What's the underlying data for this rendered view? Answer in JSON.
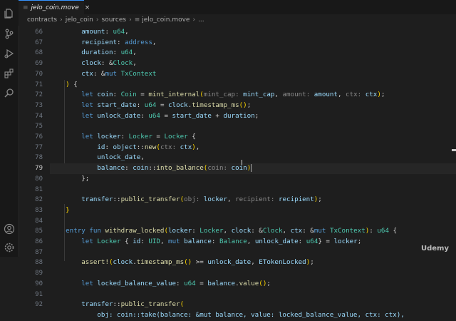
{
  "tab": {
    "icon": "≡",
    "label": "jelo_coin.move",
    "close": "×"
  },
  "breadcrumb": [
    "contracts",
    "jelo_coin",
    "sources"
  ],
  "breadcrumb_file": {
    "icon": "≡",
    "label": "jelo_coin.move"
  },
  "breadcrumb_tail": "...",
  "activity_icons": [
    "files-icon",
    "source-control-icon",
    "run-debug-icon",
    "extensions-icon",
    "search-icon",
    "account-icon",
    "settings-gear-icon"
  ],
  "line_numbers": [
    "66",
    "67",
    "68",
    "69",
    "70",
    "71",
    "72",
    "73",
    "74",
    "75",
    "76",
    "77",
    "78",
    "79",
    "80",
    "81",
    "82",
    "83",
    "84",
    "85",
    "86",
    "87",
    "88",
    "89",
    "90",
    "91",
    "92"
  ],
  "active_line": "79",
  "watermark": "Udemy",
  "code_tokens": [
    [
      [
        "id",
        "        amount"
      ],
      [
        "op",
        ": "
      ],
      [
        "ty",
        "u64"
      ],
      [
        "op",
        ","
      ]
    ],
    [
      [
        "id",
        "        recipient"
      ],
      [
        "op",
        ": "
      ],
      [
        "kw",
        "address"
      ],
      [
        "op",
        ","
      ]
    ],
    [
      [
        "id",
        "        duration"
      ],
      [
        "op",
        ": "
      ],
      [
        "ty",
        "u64"
      ],
      [
        "op",
        ","
      ]
    ],
    [
      [
        "id",
        "        clock"
      ],
      [
        "op",
        ": &"
      ],
      [
        "ty",
        "Clock"
      ],
      [
        "op",
        ","
      ]
    ],
    [
      [
        "id",
        "        ctx"
      ],
      [
        "op",
        ": &"
      ],
      [
        "kw",
        "mut "
      ],
      [
        "ty",
        "TxContext"
      ]
    ],
    [
      [
        "pn",
        "    )"
      ],
      [
        "op",
        " {"
      ]
    ],
    [
      [
        "kw",
        "        let "
      ],
      [
        "id",
        "coin"
      ],
      [
        "op",
        ": "
      ],
      [
        "ty",
        "Coin"
      ],
      [
        "op",
        " = "
      ],
      [
        "fn",
        "mint_internal"
      ],
      [
        "pn",
        "("
      ],
      [
        "hint",
        "mint_cap: "
      ],
      [
        "id",
        "mint_cap"
      ],
      [
        "op",
        ", "
      ],
      [
        "hint",
        "amount: "
      ],
      [
        "id",
        "amount"
      ],
      [
        "op",
        ", "
      ],
      [
        "hint",
        "ctx: "
      ],
      [
        "id",
        "ctx"
      ],
      [
        "pn",
        ")"
      ],
      [
        "op",
        ";"
      ]
    ],
    [
      [
        "kw",
        "        let "
      ],
      [
        "id",
        "start_date"
      ],
      [
        "op",
        ": "
      ],
      [
        "ty",
        "u64"
      ],
      [
        "op",
        " = "
      ],
      [
        "id",
        "clock"
      ],
      [
        "op",
        "."
      ],
      [
        "fn",
        "timestamp_ms"
      ],
      [
        "pn",
        "()"
      ],
      [
        "op",
        ";"
      ]
    ],
    [
      [
        "kw",
        "        let "
      ],
      [
        "id",
        "unlock_date"
      ],
      [
        "op",
        ": "
      ],
      [
        "ty",
        "u64"
      ],
      [
        "op",
        " = "
      ],
      [
        "id",
        "start_date"
      ],
      [
        "op",
        " + "
      ],
      [
        "id",
        "duration"
      ],
      [
        "op",
        ";"
      ]
    ],
    [
      [
        "op",
        ""
      ]
    ],
    [
      [
        "kw",
        "        let "
      ],
      [
        "id",
        "locker"
      ],
      [
        "op",
        ": "
      ],
      [
        "ty",
        "Locker"
      ],
      [
        "op",
        " = "
      ],
      [
        "ty",
        "Locker"
      ],
      [
        "op",
        " {"
      ]
    ],
    [
      [
        "id",
        "            id"
      ],
      [
        "op",
        ": "
      ],
      [
        "id",
        "object"
      ],
      [
        "op",
        "::"
      ],
      [
        "fn",
        "new"
      ],
      [
        "pn",
        "("
      ],
      [
        "hint",
        "ctx: "
      ],
      [
        "id",
        "ctx"
      ],
      [
        "pn",
        ")"
      ],
      [
        "op",
        ","
      ]
    ],
    [
      [
        "id",
        "            unlock_date"
      ],
      [
        "op",
        ","
      ]
    ],
    [
      [
        "id",
        "            balance"
      ],
      [
        "op",
        ": "
      ],
      [
        "id",
        "coin"
      ],
      [
        "op",
        "::"
      ],
      [
        "fn",
        "into_balance"
      ],
      [
        "pn",
        "("
      ],
      [
        "hint",
        "coin: "
      ],
      [
        "id",
        "coin"
      ],
      [
        "pn",
        ")"
      ]
    ],
    [
      [
        "op",
        "        };"
      ]
    ],
    [
      [
        "op",
        ""
      ]
    ],
    [
      [
        "id",
        "        transfer"
      ],
      [
        "op",
        "::"
      ],
      [
        "fn",
        "public_transfer"
      ],
      [
        "pn",
        "("
      ],
      [
        "hint",
        "obj: "
      ],
      [
        "id",
        "locker"
      ],
      [
        "op",
        ", "
      ],
      [
        "hint",
        "recipient: "
      ],
      [
        "id",
        "recipient"
      ],
      [
        "pn",
        ")"
      ],
      [
        "op",
        ";"
      ]
    ],
    [
      [
        "pn",
        "    }"
      ]
    ],
    [
      [
        "op",
        ""
      ]
    ],
    [
      [
        "kw",
        "    entry "
      ],
      [
        "kw",
        "fun "
      ],
      [
        "fn",
        "withdraw_locked"
      ],
      [
        "pn",
        "("
      ],
      [
        "id",
        "locker"
      ],
      [
        "op",
        ": "
      ],
      [
        "ty",
        "Locker"
      ],
      [
        "op",
        ", "
      ],
      [
        "id",
        "clock"
      ],
      [
        "op",
        ": &"
      ],
      [
        "ty",
        "Clock"
      ],
      [
        "op",
        ", "
      ],
      [
        "id",
        "ctx"
      ],
      [
        "op",
        ": &"
      ],
      [
        "kw",
        "mut "
      ],
      [
        "ty",
        "TxContext"
      ],
      [
        "pn",
        ")"
      ],
      [
        "op",
        ": "
      ],
      [
        "ty",
        "u64"
      ],
      [
        "op",
        " {"
      ]
    ],
    [
      [
        "kw",
        "        let "
      ],
      [
        "ty",
        "Locker"
      ],
      [
        "op",
        " { "
      ],
      [
        "id",
        "id"
      ],
      [
        "op",
        ": "
      ],
      [
        "ty",
        "UID"
      ],
      [
        "op",
        ", "
      ],
      [
        "kw",
        "mut "
      ],
      [
        "id",
        "balance"
      ],
      [
        "op",
        ": "
      ],
      [
        "ty",
        "Balance"
      ],
      [
        "op",
        ", "
      ],
      [
        "id",
        "unlock_date"
      ],
      [
        "op",
        ": "
      ],
      [
        "ty",
        "u64"
      ],
      [
        "op",
        "} = "
      ],
      [
        "id",
        "locker"
      ],
      [
        "op",
        ";"
      ]
    ],
    [
      [
        "op",
        ""
      ]
    ],
    [
      [
        "fn",
        "        assert!"
      ],
      [
        "pn",
        "("
      ],
      [
        "id",
        "clock"
      ],
      [
        "op",
        "."
      ],
      [
        "fn",
        "timestamp_ms"
      ],
      [
        "pn",
        "()"
      ],
      [
        "op",
        " >= "
      ],
      [
        "id",
        "unlock_date"
      ],
      [
        "op",
        ", "
      ],
      [
        "id",
        "ETokenLocked"
      ],
      [
        "pn",
        ")"
      ],
      [
        "op",
        ";"
      ]
    ],
    [
      [
        "op",
        ""
      ]
    ],
    [
      [
        "kw",
        "        let "
      ],
      [
        "id",
        "locked_balance_value"
      ],
      [
        "op",
        ": "
      ],
      [
        "ty",
        "u64"
      ],
      [
        "op",
        " = "
      ],
      [
        "id",
        "balance"
      ],
      [
        "op",
        "."
      ],
      [
        "fn",
        "value"
      ],
      [
        "pn",
        "()"
      ],
      [
        "op",
        ";"
      ]
    ],
    [
      [
        "op",
        ""
      ]
    ],
    [
      [
        "id",
        "        transfer"
      ],
      [
        "op",
        "::"
      ],
      [
        "fn",
        "public_transfer"
      ],
      [
        "pn",
        "("
      ]
    ]
  ],
  "line_93_partial": "            obj: coin::take(balance: &mut balance, value: locked_balance_value, ctx: ctx),"
}
